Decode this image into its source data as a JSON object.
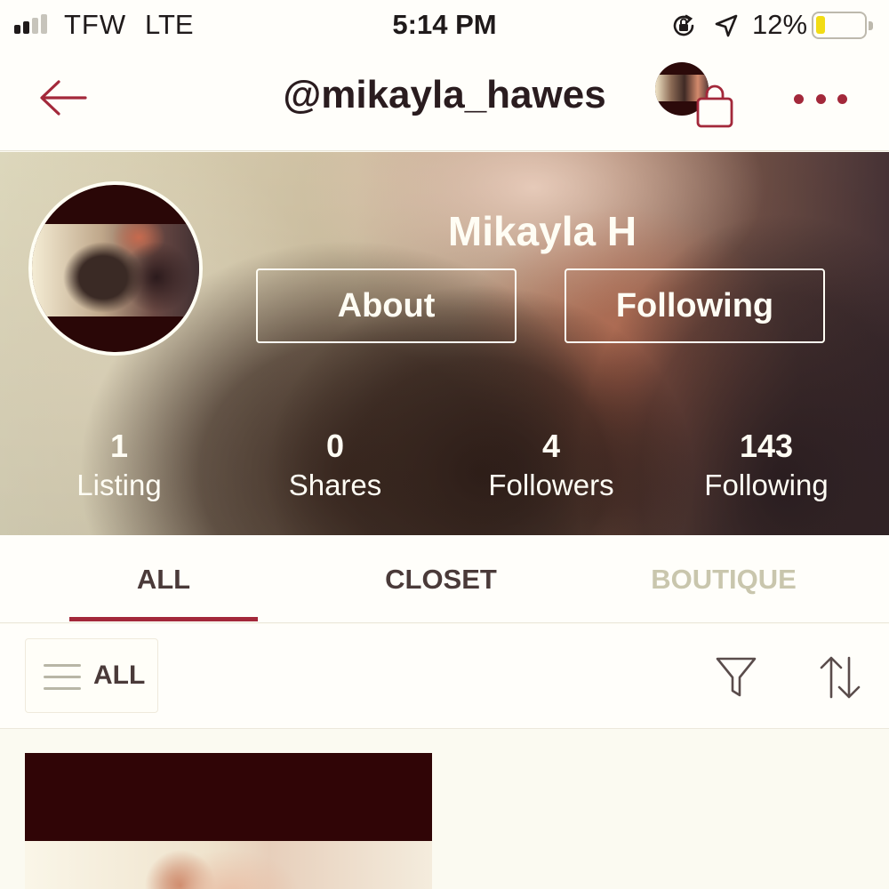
{
  "status_bar": {
    "carrier": "TFW",
    "network": "LTE",
    "time": "5:14 PM",
    "battery_percent_label": "12%",
    "battery_level": 0.12,
    "icons": [
      "signal-icon",
      "rotation-lock-icon",
      "location-arrow-icon",
      "battery-icon"
    ]
  },
  "nav": {
    "title": "@mikayla_hawes",
    "icons": [
      "back-arrow-icon",
      "shopping-bag-icon",
      "more-dots-icon"
    ]
  },
  "profile": {
    "name": "Mikayla H",
    "about_label": "About",
    "following_label": "Following",
    "stats": [
      {
        "value": "1",
        "label": "Listing"
      },
      {
        "value": "0",
        "label": "Shares"
      },
      {
        "value": "4",
        "label": "Followers"
      },
      {
        "value": "143",
        "label": "Following"
      }
    ]
  },
  "tabs": [
    {
      "label": "ALL",
      "active": true
    },
    {
      "label": "CLOSET",
      "active": false
    },
    {
      "label": "BOUTIQUE",
      "active": false,
      "disabled": true
    }
  ],
  "filter_bar": {
    "category_label": "ALL",
    "icons": [
      "menu-icon",
      "filter-icon",
      "sort-icon"
    ]
  },
  "colors": {
    "accent": "#a3283a",
    "background": "#fbfaf1",
    "text_dark": "#2a1c1f",
    "tab_inactive": "#4a3a39",
    "tab_disabled": "#c9c6ad",
    "overlay_text": "#fffdf4"
  }
}
